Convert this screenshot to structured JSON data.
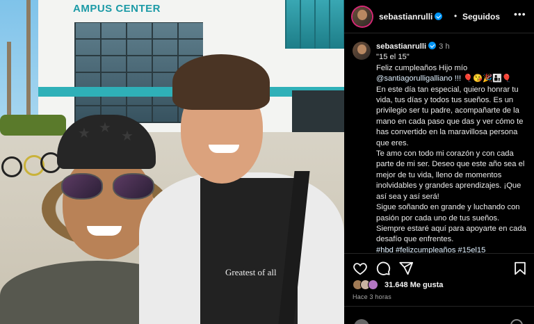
{
  "photo": {
    "building_sign": "AMPUS CENTER",
    "shirt_print": "Greatest of all"
  },
  "post": {
    "username": "sebastianrulli",
    "follow_status": "Seguidos",
    "more_label": "•••",
    "caption": {
      "username": "sebastianrulli",
      "time": "3 h",
      "lines": [
        "\"15 el 15\"",
        "Feliz cumpleaños Hijo mío",
        "@santiagorulligalliano !!! 🎈😘🎉👨‍👦🎈",
        "En este día tan especial, quiero honrar tu vida, tus días y todos tus sueños. Es un privilegio ser tu padre, acompañarte de la mano en cada paso que das y ver cómo te has convertido en la maravillosa persona que eres.",
        "Te amo con todo mi corazón y con cada parte de mi ser. Deseo que este año sea el mejor de tu vida, lleno de momentos inolvidables y grandes aprendizajes. ¡Que así sea y así será!",
        "Sigue soñando en grande y luchando con pasión por cada uno de tus sueños.",
        "Siempre estaré aquí para apoyarte en cada desafío que enfrentes.",
        "#hbd #felizcumpleaños #15el15"
      ]
    },
    "likes": "31.648 Me gusta",
    "time_ago": "Hace 3 horas"
  },
  "colors": {
    "accent_blue": "#0095f6",
    "story_ring": "#d62976",
    "panel_bg": "#000000"
  },
  "icons": [
    "heart-icon",
    "comment-icon",
    "share-icon",
    "bookmark-icon",
    "more-icon",
    "verified-icon"
  ]
}
